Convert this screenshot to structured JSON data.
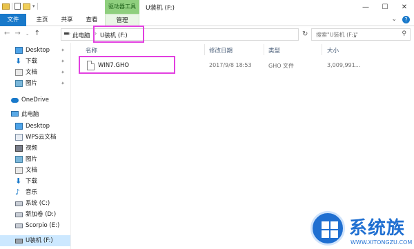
{
  "window": {
    "title": "U装机 (F:)",
    "context_tab_header": "驱动器工具",
    "controls": [
      "—",
      "☐",
      "✕"
    ]
  },
  "ribbon": {
    "tabs": [
      {
        "label": "文件"
      },
      {
        "label": "主页"
      },
      {
        "label": "共享"
      },
      {
        "label": "查看"
      },
      {
        "label": "管理"
      }
    ]
  },
  "address": {
    "crumbs": [
      "此电脑",
      "U装机 (F:)"
    ],
    "separator": "›",
    "search_placeholder": "搜索\"U装机 (F:)\""
  },
  "sidebar": {
    "quick_access": [
      {
        "label": "Desktop",
        "icon": "desktop-icon",
        "pinned": true
      },
      {
        "label": "下载",
        "icon": "download-icon",
        "pinned": true
      },
      {
        "label": "文档",
        "icon": "document-icon",
        "pinned": true
      },
      {
        "label": "图片",
        "icon": "picture-icon",
        "pinned": true
      }
    ],
    "onedrive": {
      "label": "OneDrive",
      "icon": "cloud-icon"
    },
    "this_pc": {
      "label": "此电脑",
      "icon": "computer-icon"
    },
    "pc_items": [
      {
        "label": "Desktop",
        "icon": "desktop-icon"
      },
      {
        "label": "WPS云文档",
        "icon": "folder-icon"
      },
      {
        "label": "视频",
        "icon": "video-icon"
      },
      {
        "label": "图片",
        "icon": "picture-icon"
      },
      {
        "label": "文档",
        "icon": "document-icon"
      },
      {
        "label": "下载",
        "icon": "download-icon"
      },
      {
        "label": "音乐",
        "icon": "music-icon"
      },
      {
        "label": "系统 (C:)",
        "icon": "drive-icon"
      },
      {
        "label": "新加卷 (D:)",
        "icon": "drive-icon"
      },
      {
        "label": "Scorpio (E:)",
        "icon": "drive-icon"
      },
      {
        "label": "U装机 (F:)",
        "icon": "usb-drive-icon",
        "selected": true
      }
    ]
  },
  "files": {
    "columns": [
      "名称",
      "修改日期",
      "类型",
      "大小"
    ],
    "rows": [
      {
        "name": "WIN7.GHO",
        "modified": "2017/9/8 18:53",
        "type": "GHO 文件",
        "size": "3,009,991..."
      }
    ]
  },
  "watermark": {
    "text": "系统族",
    "url": "WWW.XITONGZU.COM"
  },
  "colors": {
    "accent_blue": "#1979ca",
    "context_green": "#8fcf7e",
    "highlight_magenta": "#e23fe0",
    "selection": "#cce8ff"
  }
}
